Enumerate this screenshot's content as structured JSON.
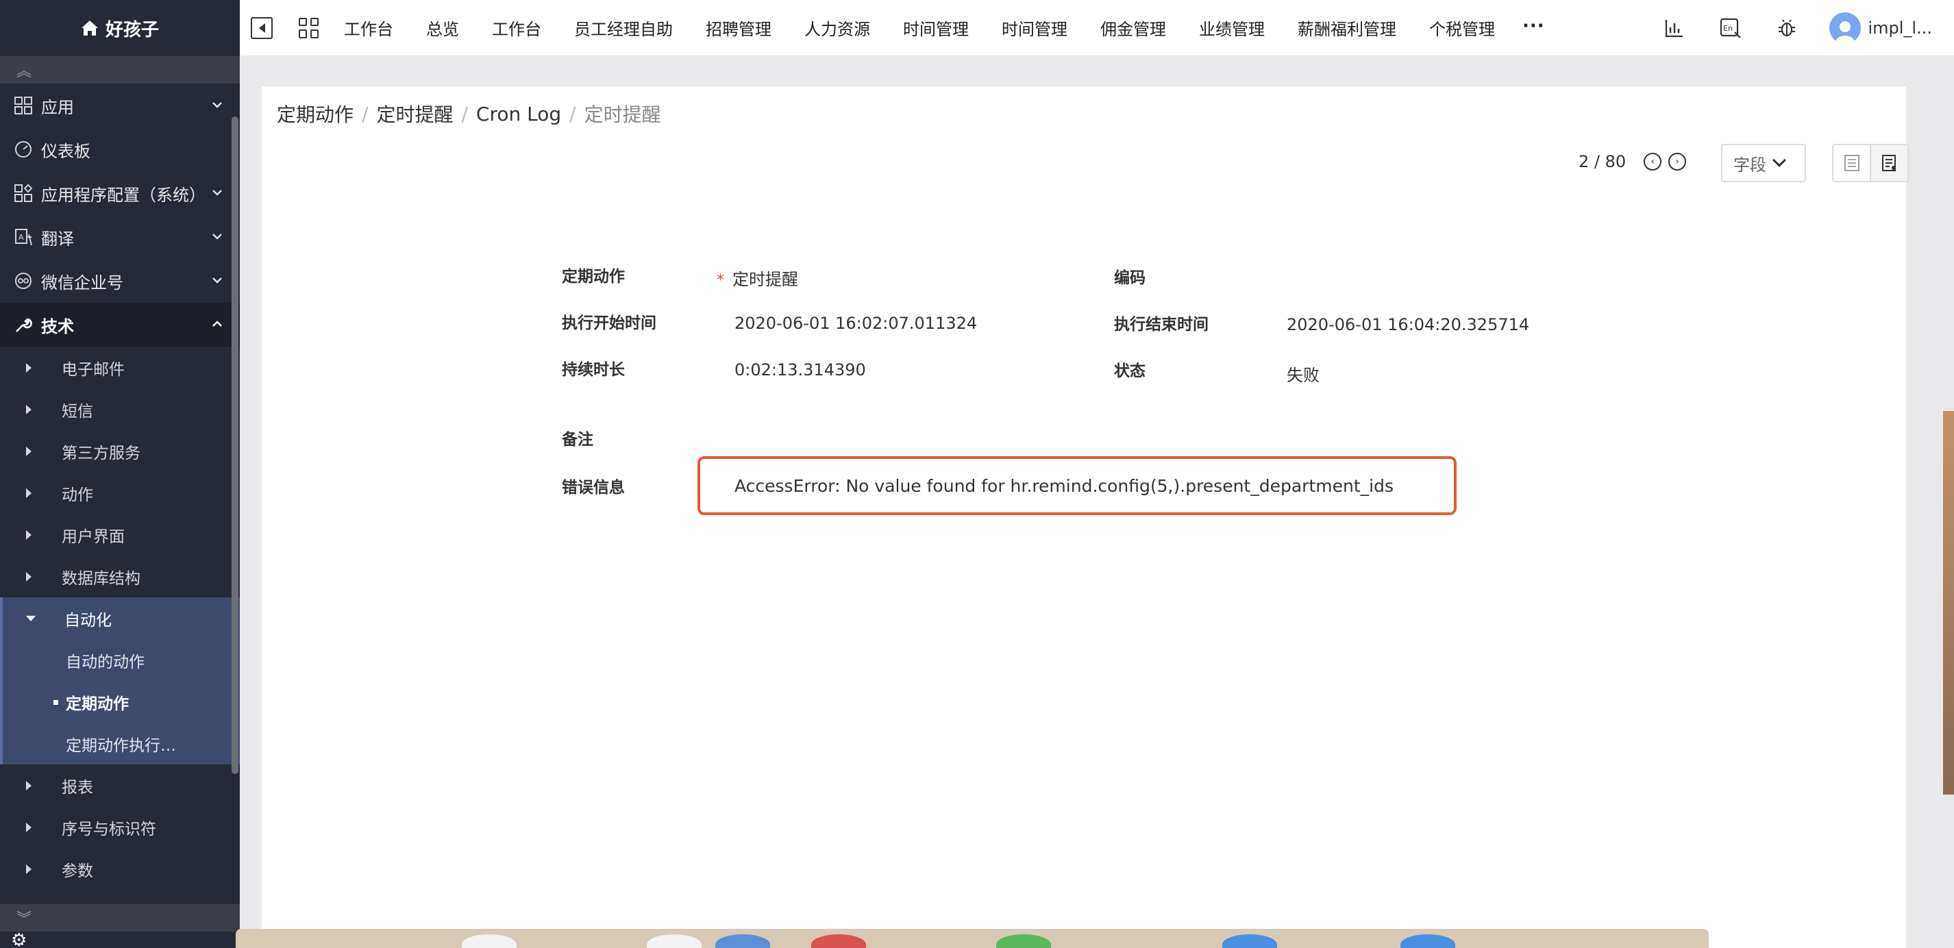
{
  "brand": {
    "name": "好孩子",
    "icon": "home-icon"
  },
  "sidebar": {
    "groups": [
      {
        "label": "应用",
        "icon": "apps-grid-icon"
      },
      {
        "label": "仪表板",
        "icon": "dashboard-gauge-icon"
      },
      {
        "label": "应用程序配置（系统）",
        "icon": "config-grid-icon"
      },
      {
        "label": "翻译",
        "icon": "translate-icon"
      },
      {
        "label": "微信企业号",
        "icon": "wechat-icon"
      },
      {
        "label": "技术",
        "icon": "wrench-icon"
      }
    ],
    "tech_items": [
      "电子邮件",
      "短信",
      "第三方服务",
      "动作",
      "用户界面",
      "数据库结构"
    ],
    "automation": {
      "label": "自动化",
      "children": [
        "自动的动作",
        "定期动作",
        "定期动作执行…"
      ]
    },
    "tech_items_after": [
      "报表",
      "序号与标识符",
      "参数"
    ]
  },
  "topnav": {
    "menu": [
      "工作台",
      "总览",
      "工作台",
      "员工经理自助",
      "招聘管理",
      "人力资源",
      "时间管理",
      "时间管理",
      "佣金管理",
      "业绩管理",
      "薪酬福利管理",
      "个税管理"
    ],
    "more": "···",
    "user": "impl_l..."
  },
  "breadcrumb": [
    "定期动作",
    "定时提醒",
    "Cron Log",
    "定时提醒"
  ],
  "pager": {
    "text": "2 / 80"
  },
  "field_select": "字段",
  "form": {
    "cron_label": "定期动作",
    "cron_value": "定时提醒",
    "code_label": "编码",
    "start_label": "执行开始时间",
    "start_value": "2020-06-01 16:02:07.011324",
    "end_label": "执行结束时间",
    "end_value": "2020-06-01 16:04:20.325714",
    "duration_label": "持续时长",
    "duration_value": "0:02:13.314390",
    "state_label": "状态",
    "state_value": "失败",
    "note_label": "备注",
    "error_label": "错误信息",
    "error_value": "AccessError: No value found for hr.remind.config(5,).present_department_ids"
  },
  "colors": {
    "sidebar_bg": "#262a36",
    "active_group": "#3e4a6c",
    "error_border": "#e45b2e",
    "required": "#e04c3b"
  }
}
